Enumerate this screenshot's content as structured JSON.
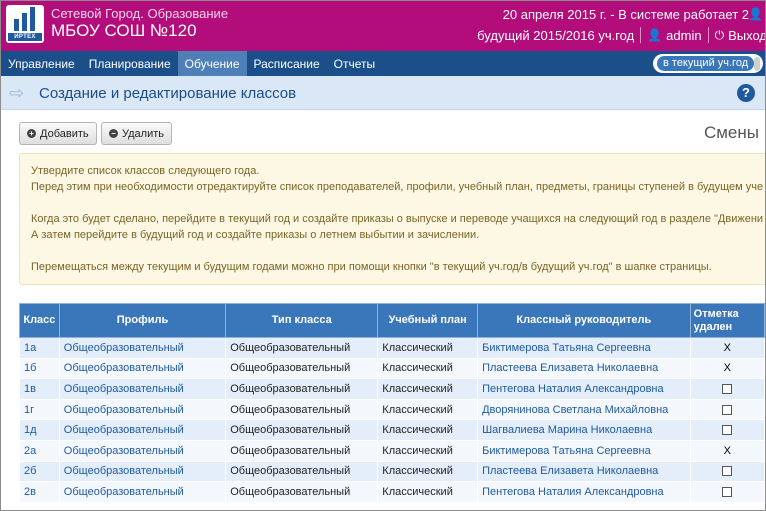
{
  "header": {
    "system_name": "Сетевой Город. Образование",
    "school_name": "МБОУ СОШ №120",
    "date_status": "20 апреля 2015 г. - В системе работает 2",
    "year_label": "будущий 2015/2016 уч.год",
    "user": "admin",
    "logout": "Выход",
    "logo_text": "ИРТЕХ"
  },
  "nav": {
    "items": [
      "Управление",
      "Планирование",
      "Обучение",
      "Расписание",
      "Отчеты"
    ],
    "active": "Обучение",
    "year_switch": "в текущий уч.год"
  },
  "title": "Создание и редактирование классов",
  "toolbar": {
    "add": "Добавить",
    "delete": "Удалить",
    "shifts": "Смены"
  },
  "info": {
    "lines": [
      "Утвердите список классов следующего года.",
      "Перед этим при необходимости отредактируйте список преподавателей, профили, учебный план, предметы, границы ступеней в будущем уче",
      "",
      "Когда это будет сделано, перейдите в текущий год и создайте приказы о выпуске и переводе учащихся на следующий год в разделе \"Движени",
      "А затем перейдите в будущий год и создайте приказы о летнем выбытии и зачислении.",
      "",
      "Перемещаться между текущим и будущим годами можно при помощи кнопки \"в текущий уч.год/в будущий уч.год\" в шапке страницы."
    ]
  },
  "table": {
    "headers": [
      "Класс",
      "Профиль",
      "Тип класса",
      "Учебный план",
      "Классный руководитель",
      "Отметка удален"
    ],
    "rows": [
      {
        "class": "1а",
        "profile": "Общеобразовательный",
        "type": "Общеобразовательный",
        "plan": "Классический",
        "teacher": "Биктимерова Татьяна Сергеевна",
        "mark": "X"
      },
      {
        "class": "1б",
        "profile": "Общеобразовательный",
        "type": "Общеобразовательный",
        "plan": "Классический",
        "teacher": "Пластеева Елизавета Николаевна",
        "mark": "X"
      },
      {
        "class": "1в",
        "profile": "Общеобразовательный",
        "type": "Общеобразовательный",
        "plan": "Классический",
        "teacher": "Пентегова Наталия Александровна",
        "mark": ""
      },
      {
        "class": "1г",
        "profile": "Общеобразовательный",
        "type": "Общеобразовательный",
        "plan": "Классический",
        "teacher": "Дворянинова Светлана Михайловна",
        "mark": ""
      },
      {
        "class": "1д",
        "profile": "Общеобразовательный",
        "type": "Общеобразовательный",
        "plan": "Классический",
        "teacher": "Шагвалиева Марина Николаевна",
        "mark": ""
      },
      {
        "class": "2а",
        "profile": "Общеобразовательный",
        "type": "Общеобразовательный",
        "plan": "Классический",
        "teacher": "Биктимерова Татьяна Сергеевна",
        "mark": "X"
      },
      {
        "class": "2б",
        "profile": "Общеобразовательный",
        "type": "Общеобразовательный",
        "plan": "Классический",
        "teacher": "Пластеева Елизавета Николаевна",
        "mark": ""
      },
      {
        "class": "2в",
        "profile": "Общеобразовательный",
        "type": "Общеобразовательный",
        "plan": "Классический",
        "teacher": "Пентегова Наталия Александровна",
        "mark": ""
      }
    ]
  }
}
